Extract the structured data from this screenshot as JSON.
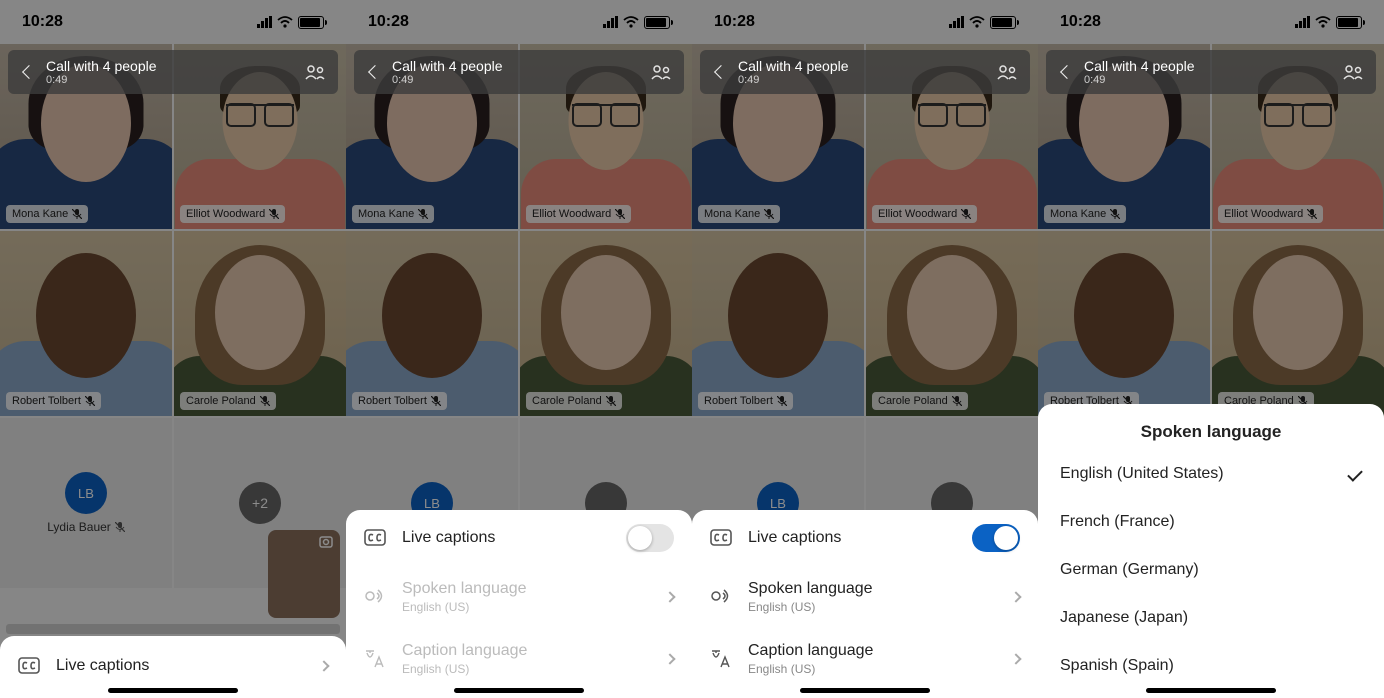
{
  "status": {
    "time": "10:28"
  },
  "header": {
    "title": "Call with 4 people",
    "duration": "0:49"
  },
  "participants": [
    {
      "name": "Mona Kane",
      "muted": true
    },
    {
      "name": "Elliot Woodward",
      "muted": true
    },
    {
      "name": "Robert Tolbert",
      "muted": true
    },
    {
      "name": "Carole Poland",
      "muted": true
    }
  ],
  "placeholders": {
    "lydia": {
      "initials": "LB",
      "name": "Lydia Bauer",
      "muted": true
    },
    "more": "+2"
  },
  "captions": {
    "row_label": "Live captions",
    "spoken_label": "Spoken language",
    "spoken_value": "English (US)",
    "caption_label": "Caption language",
    "caption_value": "English (US)"
  },
  "languages": {
    "title": "Spoken language",
    "options": [
      {
        "label": "English (United States)",
        "selected": true
      },
      {
        "label": "French (France)",
        "selected": false
      },
      {
        "label": "German (Germany)",
        "selected": false
      },
      {
        "label": "Japanese (Japan)",
        "selected": false
      },
      {
        "label": "Spanish (Spain)",
        "selected": false
      }
    ]
  },
  "colors": {
    "accent": "#0b62c4"
  }
}
